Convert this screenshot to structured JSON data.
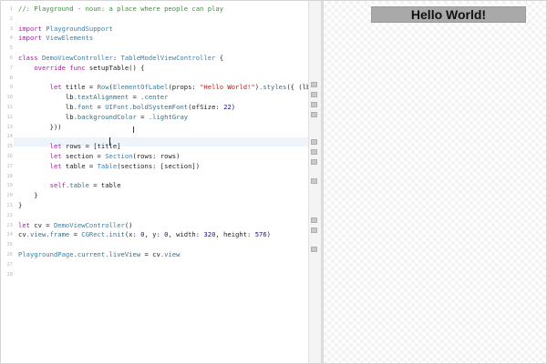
{
  "editor": {
    "lines": [
      {
        "n": "1",
        "text": "//: Playground - noun: a place where people can play"
      },
      {
        "n": "2",
        "text": ""
      },
      {
        "n": "3",
        "text": "import PlaygroundSupport"
      },
      {
        "n": "4",
        "text": "import ViewElements"
      },
      {
        "n": "5",
        "text": ""
      },
      {
        "n": "6",
        "text": "class DemoViewController: TableModelViewController {"
      },
      {
        "n": "7",
        "text": "    override func setupTable() {"
      },
      {
        "n": "8",
        "text": ""
      },
      {
        "n": "9",
        "text": "        let title = Row(ElementOfLabel(props: \"Hello World!\").styles({ (lb) in"
      },
      {
        "n": "10",
        "text": "            lb.textAlignment = .center"
      },
      {
        "n": "11",
        "text": "            lb.font = UIFont.boldSystemFont(ofSize: 22)"
      },
      {
        "n": "12",
        "text": "            lb.backgroundColor = .lightGray"
      },
      {
        "n": "13",
        "text": "        }))"
      },
      {
        "n": "14",
        "text": ""
      },
      {
        "n": "15",
        "text": "        let rows = [title]"
      },
      {
        "n": "16",
        "text": "        let section = Section(rows: rows)"
      },
      {
        "n": "17",
        "text": "        let table = Table(sections: [section])"
      },
      {
        "n": "18",
        "text": ""
      },
      {
        "n": "19",
        "text": "        self.table = table"
      },
      {
        "n": "20",
        "text": "    }"
      },
      {
        "n": "21",
        "text": "}"
      },
      {
        "n": "22",
        "text": ""
      },
      {
        "n": "23",
        "text": "let cv = DemoViewController()"
      },
      {
        "n": "24",
        "text": "cv.view.frame = CGRect.init(x: 0, y: 0, width: 320, height: 576)"
      },
      {
        "n": "25",
        "text": ""
      },
      {
        "n": "26",
        "text": "PlaygroundPage.current.liveView = cv.view"
      },
      {
        "n": "27",
        "text": ""
      },
      {
        "n": "28",
        "text": ""
      }
    ]
  },
  "live_view": {
    "label": "Hello World!"
  },
  "colors": {
    "keyword": "#a3239a",
    "type": "#3a7fa8",
    "string": "#c41a16",
    "comment": "#3f8f3f",
    "number": "#1c00cf",
    "live_cell_bg": "#a9a9a9"
  }
}
